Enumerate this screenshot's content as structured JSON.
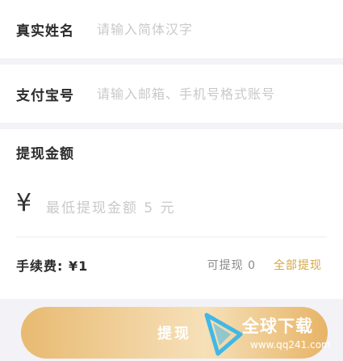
{
  "form": {
    "name_label": "真实姓名",
    "name_placeholder": "请输入简体汉字",
    "alipay_label": "支付宝号",
    "alipay_placeholder": "请输入邮箱、手机号格式账号",
    "amount_title": "提现金额",
    "currency_symbol": "¥",
    "amount_placeholder": "最低提现金额 5 元",
    "fee_text": "手续费: ¥1",
    "available_text": "可提现 0",
    "withdraw_all_label": "全部提现",
    "submit_label": "提现"
  },
  "watermark": {
    "text": "全球下载",
    "url": "www.qq241.com"
  },
  "colors": {
    "accent_gold": "#d6a646",
    "button_gradient_start": "#e8ba71",
    "button_gradient_end": "#e7b466",
    "background": "#f3f2f7"
  },
  "icons": {
    "watermark_logo": "triangle-logo-icon"
  }
}
